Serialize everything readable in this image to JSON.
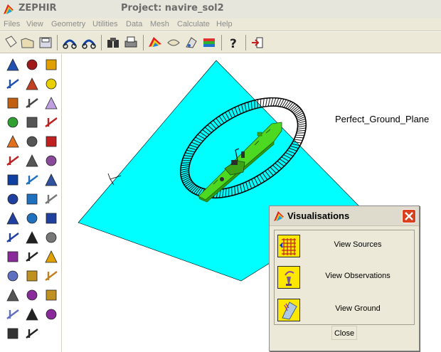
{
  "window": {
    "app_name": "ZEPHIR",
    "project_title": "Project: navire_sol2"
  },
  "menu": [
    "Files",
    "View",
    "Geometry",
    "Utilities",
    "Data",
    "Mesh",
    "Calculate",
    "Help"
  ],
  "toolbar_icons": [
    "new-file-icon",
    "open-folder-icon",
    "save-icon",
    "undo-icon",
    "redo-icon",
    "binoculars-icon",
    "print-icon",
    "rainbow-icon",
    "fly-icon",
    "paint-icon",
    "layers-icon",
    "help-icon",
    "exit-icon"
  ],
  "palette_icons": [
    "zoom-in-icon",
    "red-sphere-icon",
    "color-mesh-icon",
    "zoom-out-icon",
    "edit-note-icon",
    "prism-icon",
    "zoom-box-icon",
    "magic-wand-icon",
    "ground-reflect-icon",
    "recycle-icon",
    "d-marker-icon",
    "mesh-grid-icon",
    "color-sphere-icon",
    "e-marker-icon",
    "antenna-grid-icon",
    "red-arrow-icon",
    "d-box-icon",
    "observer-icon",
    "line-icon",
    "arrow-up-icon",
    "radio-waves-icon",
    "arc-icon",
    "arrow-up-2-icon",
    "wrench-icon",
    "spiral-icon",
    "arrow-down-icon",
    "curve-icon",
    "node-polygon-icon",
    "cross-grid-icon",
    "zoom-mesh-icon",
    "purple-surface-icon",
    "cross-grid-2-icon",
    "star-icon",
    "cube-icon",
    "surface-icon",
    "gears-icon",
    "shape-icon",
    "purple-frame-icon",
    "book-icon",
    "eraser-icon",
    "cross-grid-3-icon",
    "purple-mesh-icon",
    "nodes-elems-icon",
    "cross-grid-4-icon"
  ],
  "viewport": {
    "ground_label": "Perfect_Ground_Plane",
    "colors": {
      "ground": "#00ffff",
      "ship": "#4dd821",
      "ring": "#000000"
    }
  },
  "dialog": {
    "title": "Visualisations",
    "items": [
      {
        "label": "View Sources",
        "icon": "sources-icon"
      },
      {
        "label": "View Observations",
        "icon": "observations-icon"
      },
      {
        "label": "View Ground",
        "icon": "ground-icon"
      }
    ],
    "close_label": "Close"
  }
}
